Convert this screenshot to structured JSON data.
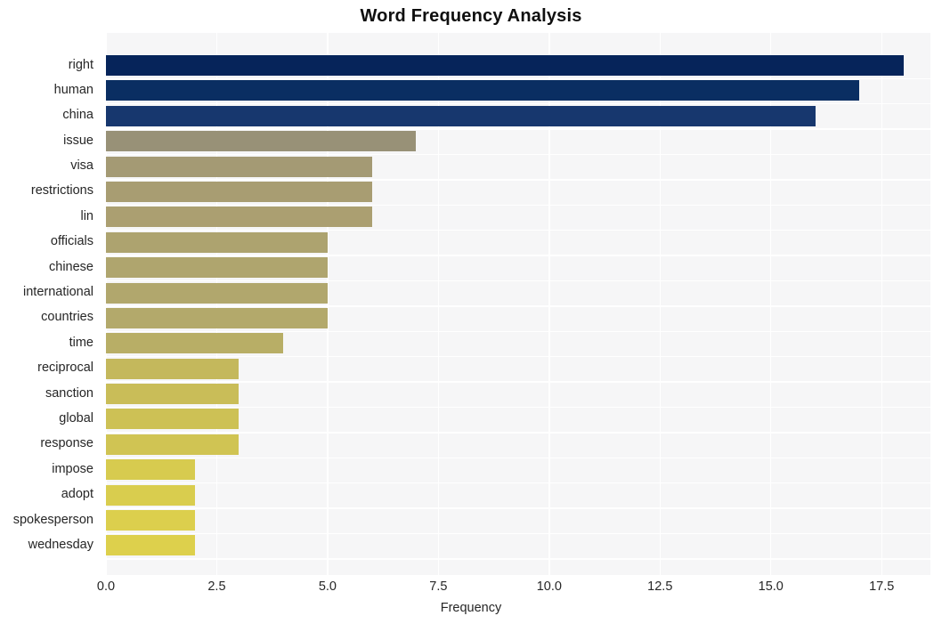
{
  "chart_data": {
    "type": "bar",
    "orientation": "horizontal",
    "title": "Word Frequency Analysis",
    "xlabel": "Frequency",
    "ylabel": "",
    "xlim": [
      0,
      18.6
    ],
    "xticks": [
      "0.0",
      "2.5",
      "5.0",
      "7.5",
      "10.0",
      "12.5",
      "15.0",
      "17.5"
    ],
    "xtick_values": [
      0,
      2.5,
      5,
      7.5,
      10,
      12.5,
      15,
      17.5
    ],
    "grid": true,
    "legend": "none",
    "categories": [
      "right",
      "human",
      "china",
      "issue",
      "visa",
      "restrictions",
      "lin",
      "officials",
      "chinese",
      "international",
      "countries",
      "time",
      "reciprocal",
      "sanction",
      "global",
      "response",
      "impose",
      "adopt",
      "spokesperson",
      "wednesday"
    ],
    "values": [
      18,
      17,
      16,
      7,
      6,
      6,
      6,
      5,
      5,
      5,
      5,
      4,
      3,
      3,
      3,
      3,
      2,
      2,
      2,
      2
    ],
    "bar_colors": [
      "#06245a",
      "#0a2e62",
      "#17376e",
      "#989177",
      "#a49a74",
      "#a89d72",
      "#ab9f71",
      "#ada36f",
      "#afa56e",
      "#b1a76d",
      "#b3a96b",
      "#b8ae66",
      "#c4b85c",
      "#c9bd58",
      "#cdc155",
      "#d0c453",
      "#d7cb4f",
      "#d9cd4e",
      "#dccf4d",
      "#ddd04c"
    ],
    "plot_background": "#f6f6f7",
    "grid_color": "#ffffff",
    "figure_background": "#ffffff",
    "text_color": "#262626",
    "title_color": "#0f0f0f"
  }
}
